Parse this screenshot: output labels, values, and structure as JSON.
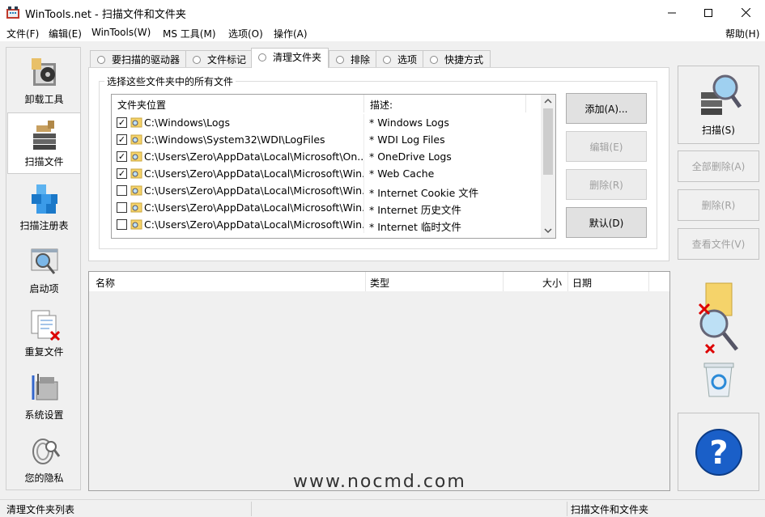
{
  "window": {
    "title": "WinTools.net - 扫描文件和文件夹"
  },
  "menu": [
    "文件(F)",
    "编辑(E)",
    "WinTools(W)",
    "MS 工具(M)",
    "选项(O)",
    "操作(A)"
  ],
  "menu_help": "帮助(H)",
  "sidebar": [
    {
      "label": "卸载工具",
      "icon": "uninstall-icon",
      "active": false
    },
    {
      "label": "扫描文件",
      "icon": "scan-files-icon",
      "active": true
    },
    {
      "label": "扫描注册表",
      "icon": "registry-icon",
      "active": false
    },
    {
      "label": "启动项",
      "icon": "startup-icon",
      "active": false
    },
    {
      "label": "重复文件",
      "icon": "duplicate-files-icon",
      "active": false
    },
    {
      "label": "系统设置",
      "icon": "system-settings-icon",
      "active": false
    },
    {
      "label": "您的隐私",
      "icon": "privacy-icon",
      "active": false
    }
  ],
  "tabs": [
    "要扫描的驱动器",
    "文件标记",
    "清理文件夹",
    "排除",
    "选项",
    "快捷方式"
  ],
  "active_tab": 2,
  "group_title": "选择这些文件夹中的所有文件",
  "folder_list": {
    "columns": [
      "文件夹位置",
      "描述:"
    ],
    "rows": [
      {
        "checked": true,
        "path": "C:\\Windows\\Logs",
        "desc": "* Windows Logs"
      },
      {
        "checked": true,
        "path": "C:\\Windows\\System32\\WDI\\LogFiles",
        "desc": "* WDI Log Files"
      },
      {
        "checked": true,
        "path": "C:\\Users\\Zero\\AppData\\Local\\Microsoft\\On...",
        "desc": "* OneDrive Logs"
      },
      {
        "checked": true,
        "path": "C:\\Users\\Zero\\AppData\\Local\\Microsoft\\Win...",
        "desc": "* Web Cache"
      },
      {
        "checked": false,
        "path": "C:\\Users\\Zero\\AppData\\Local\\Microsoft\\Win...",
        "desc": "* Internet Cookie 文件"
      },
      {
        "checked": false,
        "path": "C:\\Users\\Zero\\AppData\\Local\\Microsoft\\Win...",
        "desc": "* Internet 历史文件"
      },
      {
        "checked": false,
        "path": "C:\\Users\\Zero\\AppData\\Local\\Microsoft\\Win...",
        "desc": "* Internet 临时文件"
      }
    ]
  },
  "folder_buttons": {
    "add": "添加(A)...",
    "edit": "编辑(E)",
    "delete": "删除(R)",
    "default": "默认(D)"
  },
  "results": {
    "columns": [
      "名称",
      "类型",
      "大小",
      "日期"
    ]
  },
  "right_panel": {
    "scan": "扫描(S)",
    "delete_all": "全部删除(A)",
    "delete": "删除(R)",
    "view_file": "查看文件(V)"
  },
  "watermark": "www.nocmd.com",
  "status": {
    "left": "清理文件夹列表",
    "right": "扫描文件和文件夹"
  }
}
